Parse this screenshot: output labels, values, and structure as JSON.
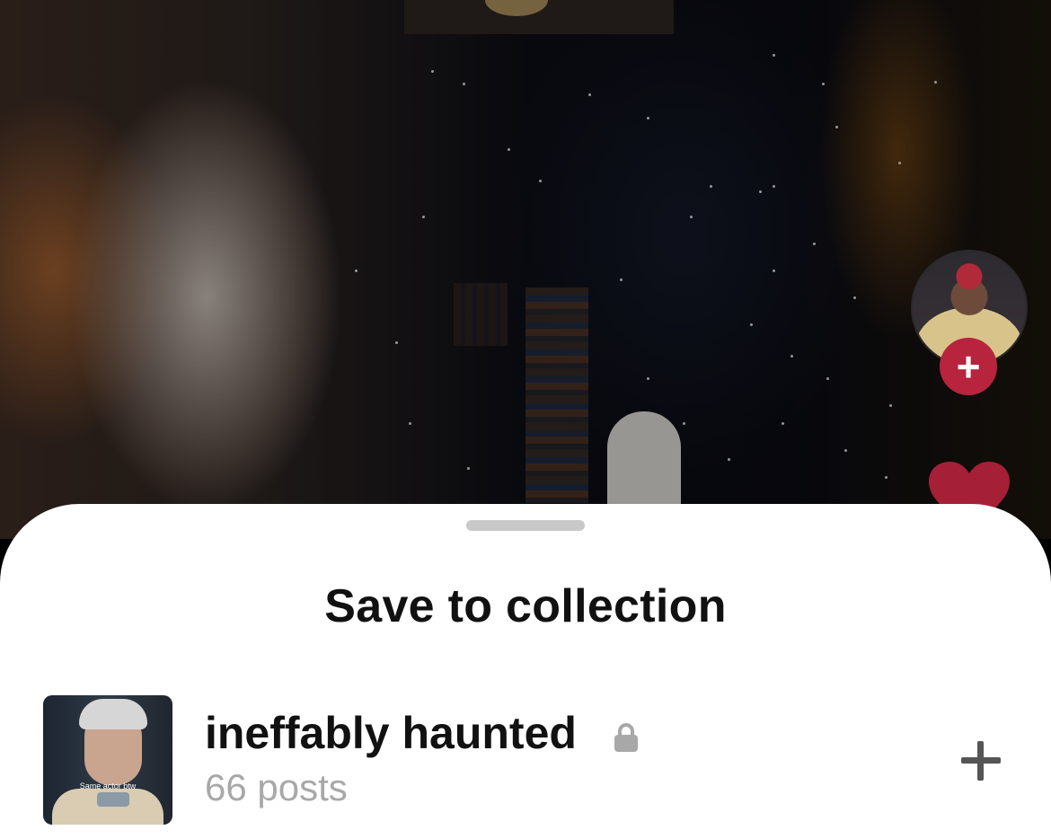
{
  "sheet": {
    "title": "Save to collection"
  },
  "collections": [
    {
      "name": "ineffably haunted",
      "count": "66 posts",
      "private": true,
      "thumbnail_caption": "Same actor btw"
    }
  ],
  "colors": {
    "accent": "#b8233d",
    "sheet_background": "#ffffff",
    "secondary_text": "#a8a8a8",
    "handle": "#c9c9c9"
  },
  "icons": {
    "follow": "plus-icon",
    "like": "heart-icon",
    "private": "lock-icon",
    "add": "plus-icon"
  }
}
